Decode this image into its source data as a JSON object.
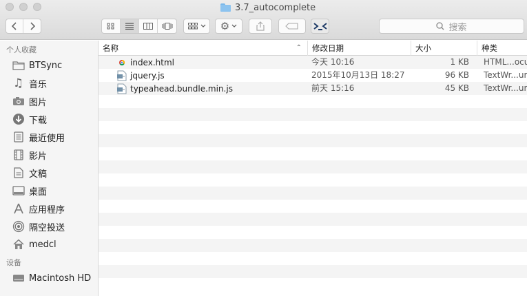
{
  "window": {
    "title": "3.7_autocomplete"
  },
  "toolbar": {
    "search_placeholder": "搜索"
  },
  "sidebar": {
    "favorites_header": "个人收藏",
    "favorites": [
      {
        "label": "BTSync",
        "icon": "folder-icon"
      },
      {
        "label": "音乐",
        "icon": "music-icon"
      },
      {
        "label": "图片",
        "icon": "camera-icon"
      },
      {
        "label": "下载",
        "icon": "download-icon"
      },
      {
        "label": "最近使用",
        "icon": "recents-icon"
      },
      {
        "label": "影片",
        "icon": "film-icon"
      },
      {
        "label": "文稿",
        "icon": "document-icon"
      },
      {
        "label": "桌面",
        "icon": "desktop-icon"
      },
      {
        "label": "应用程序",
        "icon": "applications-icon"
      },
      {
        "label": "隔空投送",
        "icon": "airdrop-icon"
      },
      {
        "label": "medcl",
        "icon": "home-icon"
      }
    ],
    "devices_header": "设备",
    "devices": [
      {
        "label": "Macintosh HD",
        "icon": "hard-drive-icon"
      }
    ]
  },
  "columns": {
    "name": "名称",
    "date": "修改日期",
    "size": "大小",
    "kind": "种类"
  },
  "files": [
    {
      "name": "index.html",
      "date": "今天 10:16",
      "size": "1 KB",
      "kind": "HTML...ocu",
      "icon": "chrome-html-icon"
    },
    {
      "name": "jquery.js",
      "date": "2015年10月13日 18:27",
      "size": "96 KB",
      "kind": "TextWr...ument",
      "icon": "script-icon"
    },
    {
      "name": "typeahead.bundle.min.js",
      "date": "前天 15:16",
      "size": "45 KB",
      "kind": "TextWr...ument",
      "icon": "script-icon"
    }
  ]
}
